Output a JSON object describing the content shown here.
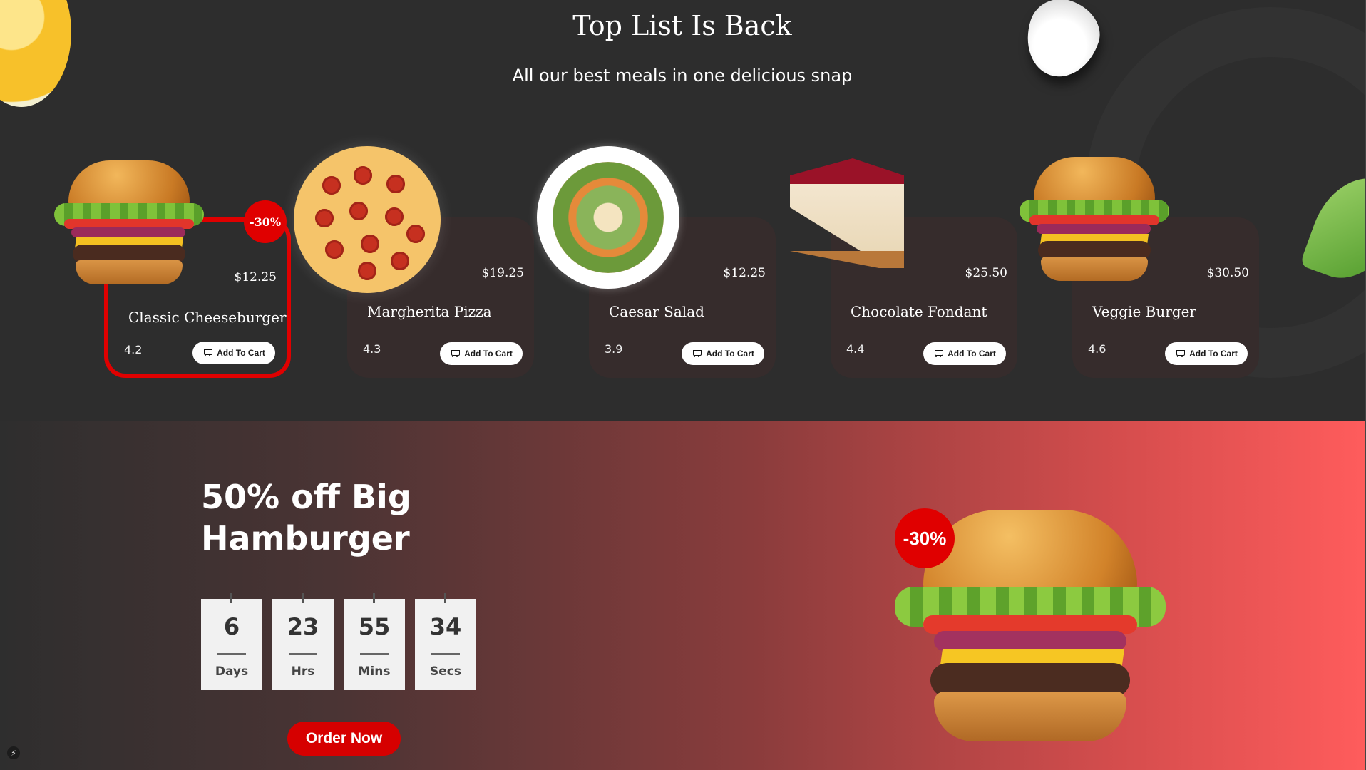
{
  "top": {
    "title": "Top List Is Back",
    "subtitle": "All our best meals in one delicious snap"
  },
  "cards": [
    {
      "name": "Classic Cheeseburger",
      "price": "$12.25",
      "rating": "4.2",
      "button": "Add To Cart",
      "badge": "-30%",
      "image": "burger"
    },
    {
      "name": "Margherita Pizza",
      "price": "$19.25",
      "rating": "4.3",
      "button": "Add To Cart",
      "image": "pizza"
    },
    {
      "name": "Caesar Salad",
      "price": "$12.25",
      "rating": "3.9",
      "button": "Add To Cart",
      "image": "salad"
    },
    {
      "name": "Chocolate Fondant",
      "price": "$25.50",
      "rating": "4.4",
      "button": "Add To Cart",
      "image": "cake"
    },
    {
      "name": "Veggie Burger",
      "price": "$30.50",
      "rating": "4.6",
      "button": "Add To Cart",
      "image": "burger"
    }
  ],
  "promo": {
    "title": "50% off Big Hamburger",
    "badge": "-30%",
    "countdown": [
      {
        "value": "6",
        "label": "Days"
      },
      {
        "value": "23",
        "label": "Hrs"
      },
      {
        "value": "55",
        "label": "Mins"
      },
      {
        "value": "34",
        "label": "Secs"
      }
    ],
    "cta": "Order Now"
  },
  "colors": {
    "accent": "#e00000",
    "card_bg": "#362c2c",
    "page_bg": "#2d2d2d",
    "gradient_end": "#ff5c5c"
  },
  "icons": [
    "cart-icon",
    "lightning-icon"
  ]
}
